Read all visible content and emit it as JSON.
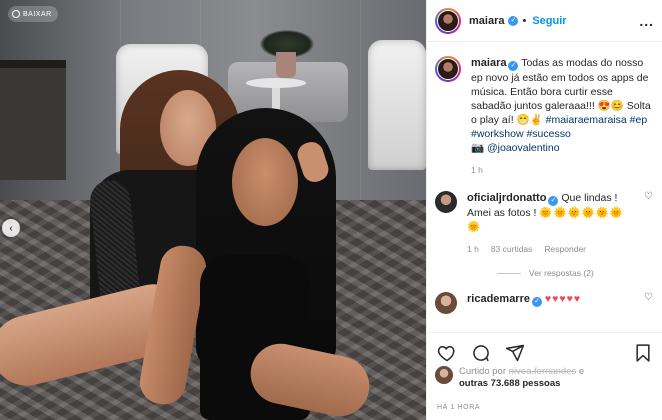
{
  "photo": {
    "save_chip_label": "BAIXAR",
    "prev_button": "‹"
  },
  "header": {
    "username": "maiara",
    "follow_separator": "•",
    "follow_label": "Seguir",
    "more_label": "..."
  },
  "caption": {
    "username": "maiara",
    "text": "Todas as modas do nosso ep novo já estão em todos os apps de música. Então bora curtir esse sabadão juntos galeraaa!!! 😍😊 Solta o play aí! 😁✌",
    "hashtags": "#maiaraemaraisa #ep #workshow #sucesso",
    "camera_emoji": "📷",
    "mention": "@joaovalentino",
    "time": "1 h"
  },
  "comments": [
    {
      "username": "oficialjrdonatto",
      "text": "Que lindas ! Amei as fotos ! ",
      "emojis": "🌞🌞🌞🌞🌞🌞🌞",
      "time": "1 h",
      "likes": "83 curtidas",
      "reply": "Responder"
    },
    {
      "username": "ricademarre",
      "emojis": "♥♥♥♥♥"
    }
  ],
  "view_replies": "Ver respostas (2)",
  "likes": {
    "liked_by_label": "Curtido por",
    "liked_by_user": "nivea.fernandes",
    "and_label": "e",
    "others": "outras 73.688 pessoas"
  },
  "timestamp": "HÁ 1 HORA",
  "colors": {
    "link": "#0095f6",
    "verified": "#3897f0",
    "hashtag": "#00376b",
    "muted": "#8e8e8e",
    "heart_red": "#ed4956"
  },
  "icons": {
    "like": "heart-icon",
    "comment": "comment-icon",
    "share": "share-icon",
    "save": "bookmark-icon"
  }
}
